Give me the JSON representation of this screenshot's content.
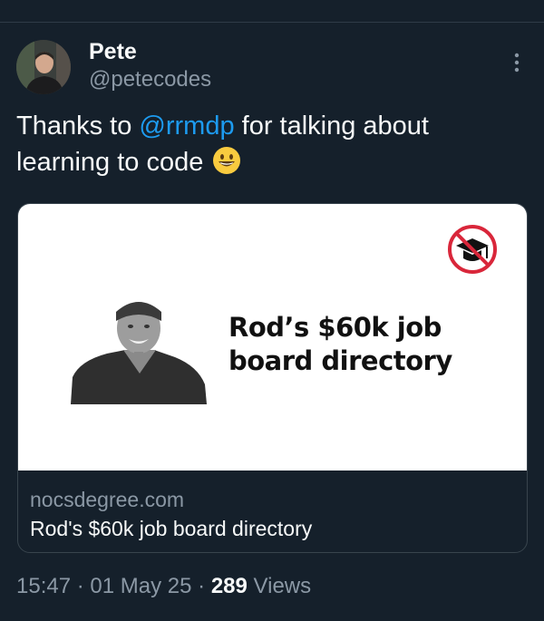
{
  "tweet": {
    "author_name": "Pete",
    "author_handle": "@petecodes",
    "text_before": "Thanks to ",
    "mention": "@rrmdp",
    "text_after": " for talking about learning to code",
    "emoji": "grinning-face-icon"
  },
  "card": {
    "headline": "Rod’s $60k job board directory",
    "domain": "nocsdegree.com",
    "title": "Rod's $60k job board directory"
  },
  "meta": {
    "time": "15:47",
    "separator": "·",
    "date": "01 May 25",
    "views_count": "289",
    "views_label": "Views"
  },
  "colors": {
    "background": "#15202b",
    "mention": "#1d9bf0",
    "secondary_text": "#8b98a5",
    "primary_text": "#f7f9f9"
  }
}
